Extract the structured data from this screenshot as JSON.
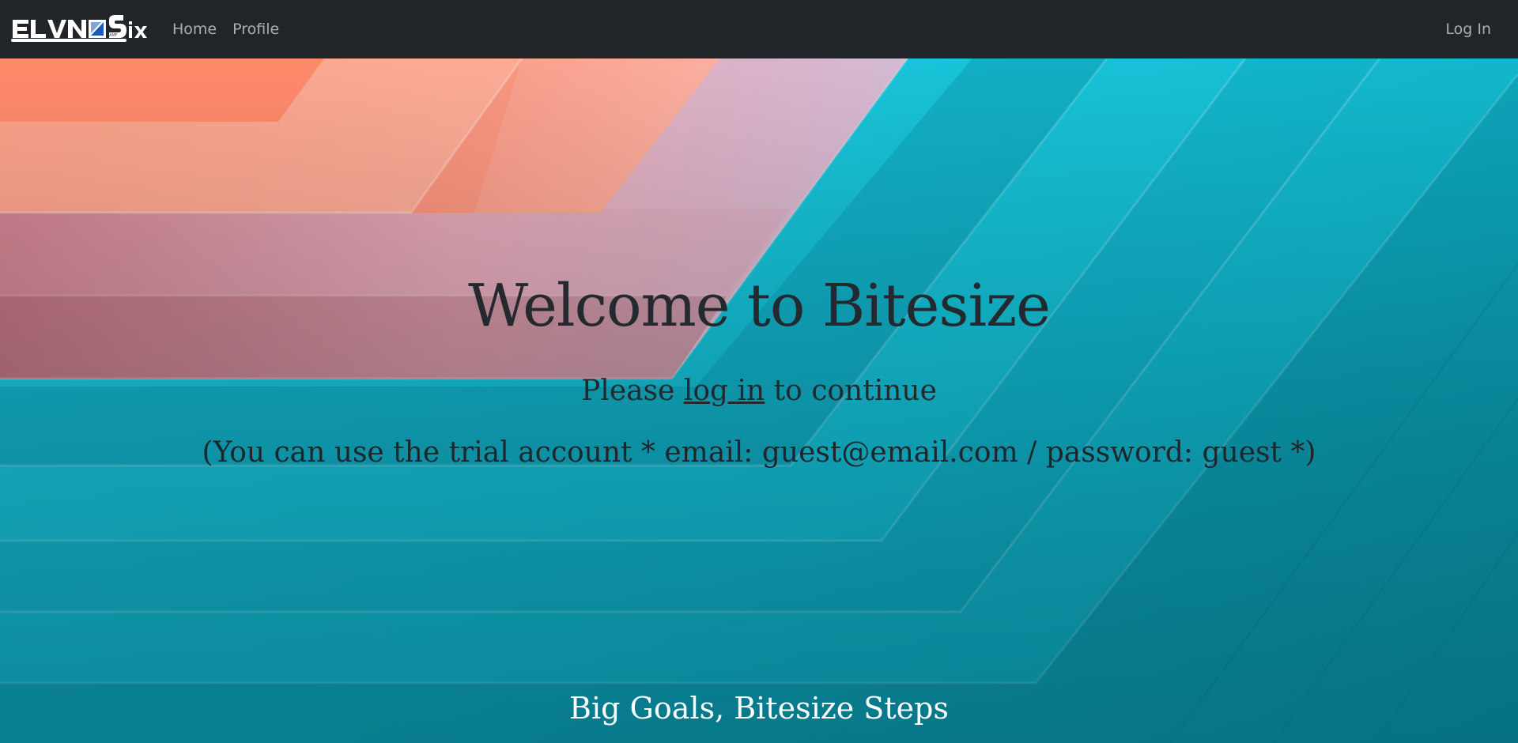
{
  "navbar": {
    "logo_text": "ELVN SIX",
    "links": [
      {
        "label": "Home"
      },
      {
        "label": "Profile"
      }
    ],
    "login_label": "Log In"
  },
  "hero": {
    "title": "Welcome to Bitesize",
    "sub_prefix": "Please ",
    "sub_link": "log in",
    "sub_suffix": " to continue",
    "note": "(You can use the trial account * email: guest@email.com / password: guest *)",
    "tagline": "Big Goals, Bitesize Steps"
  },
  "colors": {
    "navbar_bg": "#212529",
    "nav_link": "rgba(255,255,255,0.62)",
    "hero_text": "#23292e",
    "tagline": "#ffffff",
    "teal": "#13c3d9",
    "coral": "#f9836a",
    "pink": "#dcb3c9"
  }
}
